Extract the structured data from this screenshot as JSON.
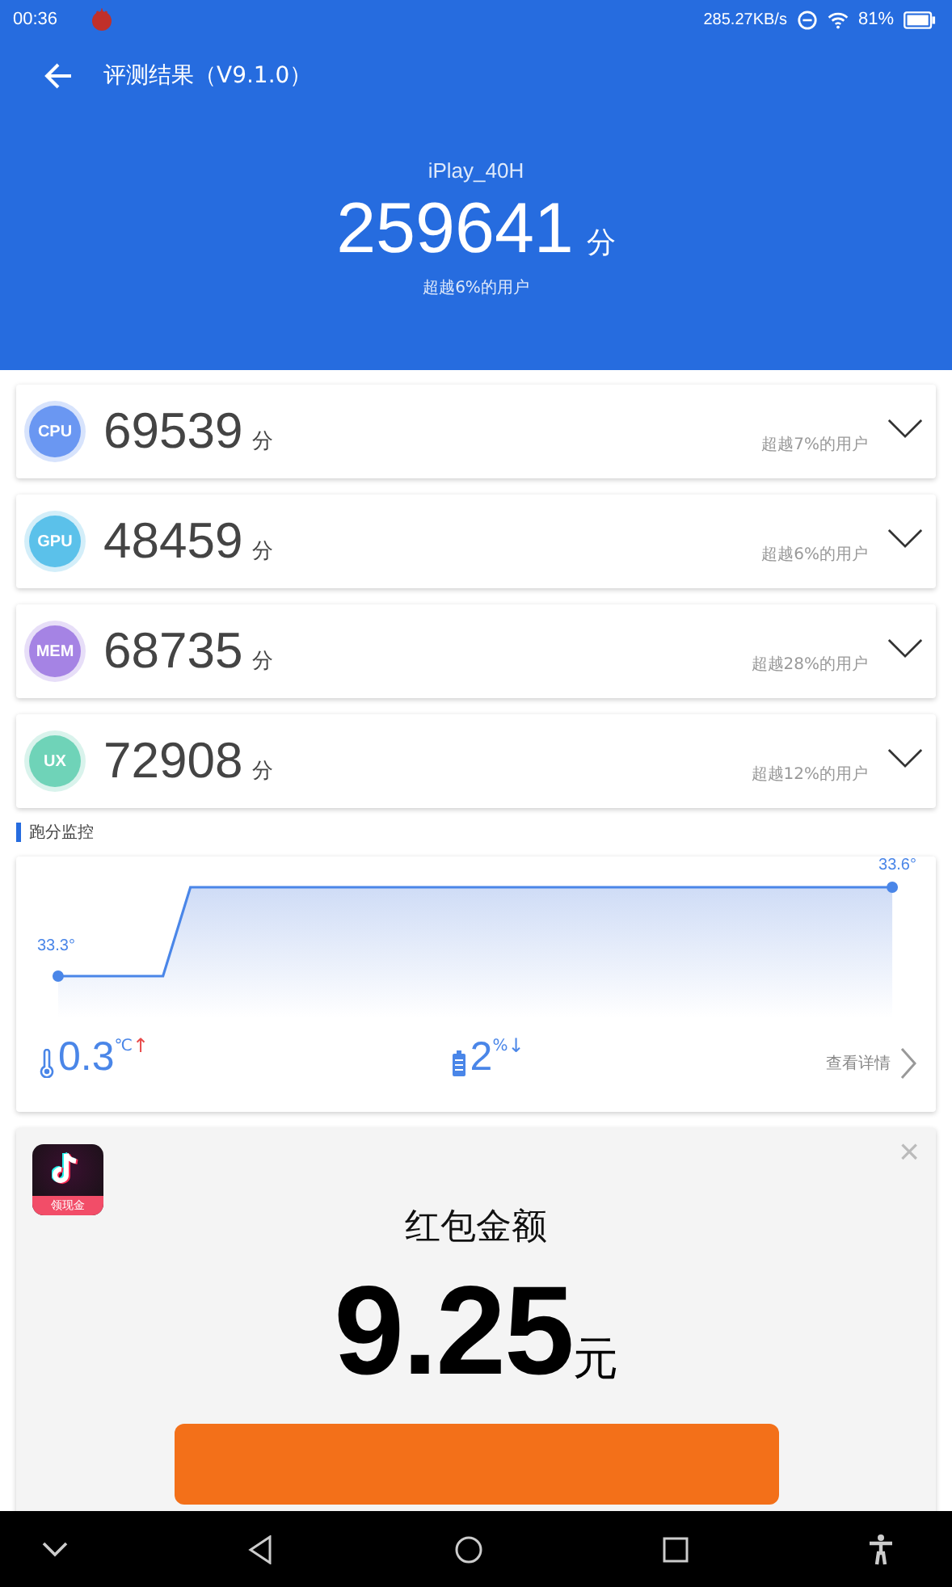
{
  "status_bar": {
    "time": "00:36",
    "speed": "285.27KB/s",
    "battery": "81%"
  },
  "header": {
    "title": "评测结果（V9.1.0）",
    "device": "iPlay_40H",
    "score": "259641",
    "unit": "分",
    "rank": "超越6%的用户"
  },
  "scores": [
    {
      "label": "CPU",
      "color": "#6a97f2",
      "score": "69539",
      "unit": "分",
      "rank": "超越7%的用户",
      "expanded": false
    },
    {
      "label": "GPU",
      "color": "#5bc1ea",
      "score": "48459",
      "unit": "分",
      "rank": "超越6%的用户",
      "expanded": false
    },
    {
      "label": "MEM",
      "color": "#a583e4",
      "score": "68735",
      "unit": "分",
      "rank": "超越28%的用户",
      "expanded": false
    },
    {
      "label": "UX",
      "color": "#6fd3b8",
      "score": "72908",
      "unit": "分",
      "rank": "超越12%的用户",
      "expanded": false
    }
  ],
  "monitor": {
    "title": "跑分监控",
    "start_label": "33.3°",
    "end_label": "33.6°",
    "temp_change": "0.3",
    "temp_unit": "℃",
    "temp_arrow": "↑",
    "battery_change": "2",
    "battery_unit": "%",
    "battery_arrow": "↓",
    "details": "查看详情"
  },
  "ad": {
    "app_badge": "领现金",
    "title": "红包金额",
    "amount": "9.25",
    "currency": "元",
    "close": "×"
  }
}
